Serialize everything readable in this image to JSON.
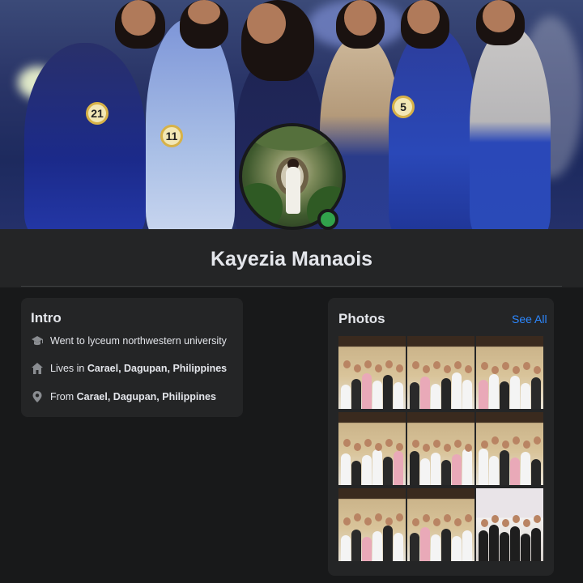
{
  "profile": {
    "name": "Kayezia Manaois",
    "online": true
  },
  "cover": {
    "badges": [
      "21",
      "11",
      "5"
    ]
  },
  "intro": {
    "title": "Intro",
    "items": [
      {
        "icon": "graduation-cap-icon",
        "prefix": "Went to lyceum northwestern university",
        "strong": ""
      },
      {
        "icon": "home-icon",
        "prefix": "Lives in ",
        "strong": "Carael, Dagupan, Philippines"
      },
      {
        "icon": "location-pin-icon",
        "prefix": "From ",
        "strong": "Carael, Dagupan, Philippines"
      }
    ]
  },
  "photos": {
    "title": "Photos",
    "see_all": "See All",
    "count": 9
  },
  "colors": {
    "background": "#18191a",
    "card": "#242526",
    "text": "#e4e6eb",
    "link": "#2d88ff",
    "online": "#31a24c"
  }
}
